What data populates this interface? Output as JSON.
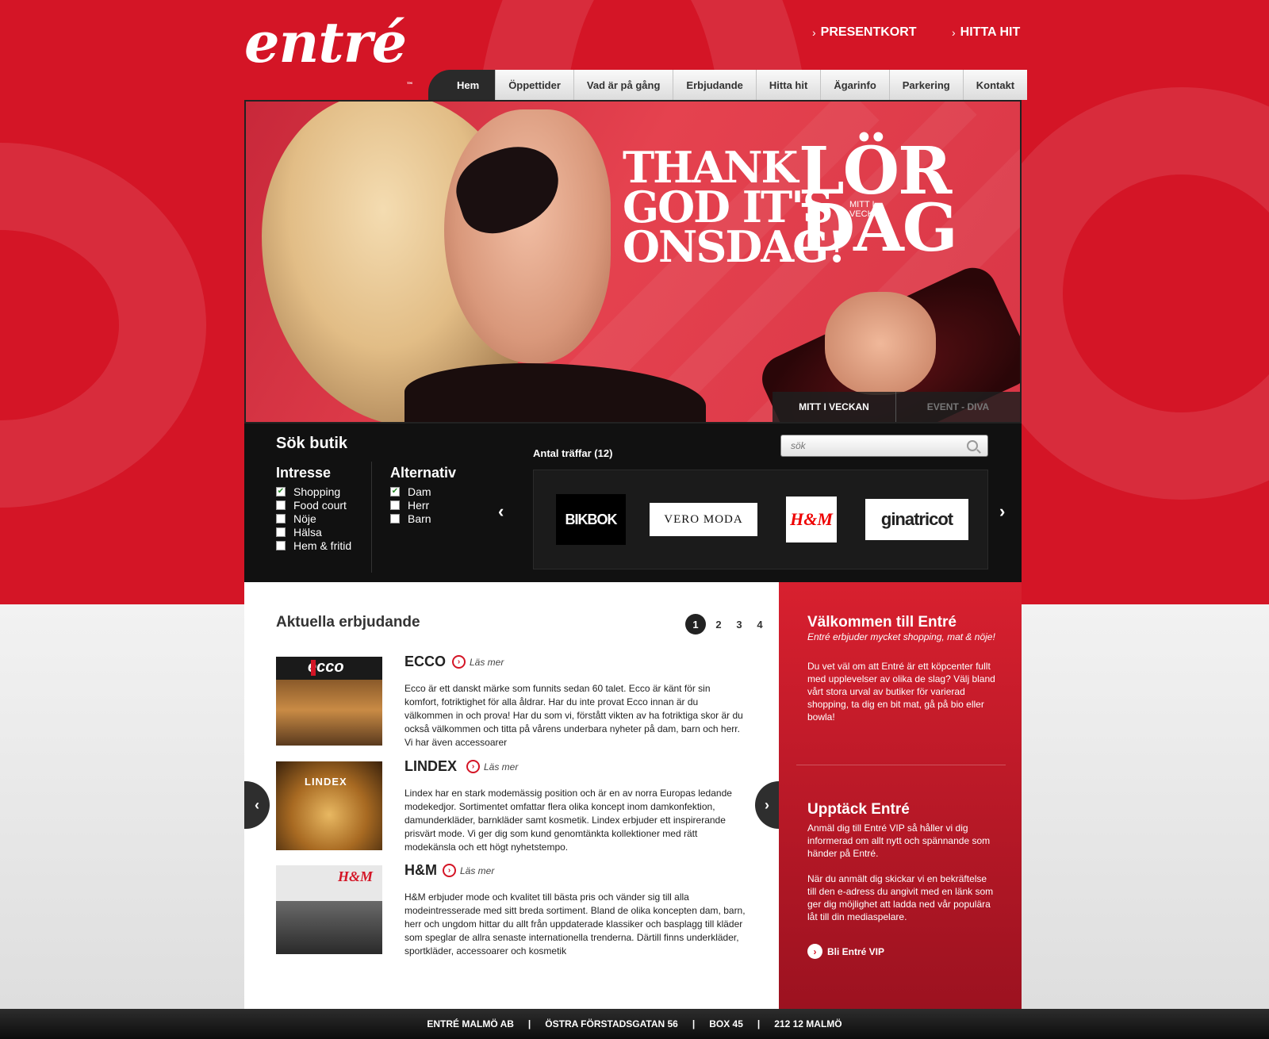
{
  "brand": {
    "logo_text": "entré",
    "tm": "™"
  },
  "top_links": [
    {
      "label": "PRESENTKORT"
    },
    {
      "label": "HITTA HIT"
    }
  ],
  "nav": [
    "Hem",
    "Öppettider",
    "Vad är på gång",
    "Erbjudande",
    "Hitta hit",
    "Ägarinfo",
    "Parkering",
    "Kontakt"
  ],
  "hero": {
    "headline_left": [
      "THANK",
      "GOD IT'S",
      "ONSDAG!"
    ],
    "headline_right": [
      "LÖR",
      "DAG"
    ],
    "headline_small": "MITT I VECKAN",
    "tabs": [
      "MITT I VECKAN",
      "EVENT - DIVA"
    ]
  },
  "search": {
    "title": "Sök butik",
    "interest_title": "Intresse",
    "interests": [
      {
        "label": "Shopping",
        "checked": true
      },
      {
        "label": "Food court",
        "checked": false
      },
      {
        "label": "Nöje",
        "checked": false
      },
      {
        "label": "Hälsa",
        "checked": false
      },
      {
        "label": "Hem & fritid",
        "checked": false
      }
    ],
    "alt_title": "Alternativ",
    "alternatives": [
      {
        "label": "Dam",
        "checked": true
      },
      {
        "label": "Herr",
        "checked": false
      },
      {
        "label": "Barn",
        "checked": false
      }
    ],
    "hits_label": "Antal träffar (12)",
    "search_placeholder": "sök",
    "brands": [
      "BIKBOK",
      "VERO MODA",
      "H&M",
      "ginatricot"
    ]
  },
  "offers": {
    "title": "Aktuella erbjudande",
    "pages": [
      "1",
      "2",
      "3",
      "4"
    ],
    "read_more": "Läs mer",
    "items": [
      {
        "name": "ECCO",
        "img_label": "ecco",
        "text": "Ecco är ett danskt märke som funnits sedan 60 talet. Ecco är känt för sin komfort, fotriktighet för alla åldrar. Har du inte provat Ecco innan är du välkommen in och prova! Har du som vi, förstått vikten av ha fotriktiga skor är du också välkommen och titta på vårens underbara nyheter på dam, barn och herr. Vi har även accessoarer"
      },
      {
        "name": "LINDEX",
        "img_label": "LINDEX",
        "text": "Lindex har en stark modemässig position och är en av norra Europas ledande modekedjor. Sortimentet omfattar flera olika koncept inom damkonfektion, damunderkläder, barnkläder samt kosmetik. Lindex erbjuder ett inspirerande prisvärt mode. Vi ger dig som kund genomtänkta kollektioner med rätt modekänsla och ett högt nyhetstempo."
      },
      {
        "name": "H&M",
        "img_label": "H&M",
        "text": "H&M erbjuder mode och kvalitet till bästa pris och vänder sig till alla modeintresserade med sitt breda sortiment. Bland de olika koncepten dam, barn, herr och ungdom hittar du allt från uppdaterade klassiker och basplagg till kläder som speglar de allra senaste internationella trenderna. Därtill finns underkläder, sportkläder, accessoarer och kosmetik"
      }
    ]
  },
  "sidebar": {
    "welcome_title": "Välkommen till Entré",
    "welcome_sub": "Entré erbjuder mycket shopping, mat & nöje!",
    "welcome_text": "Du vet väl om att Entré är ett köpcenter fullt med upplevelser av olika de slag? Välj bland vårt stora urval av butiker för varierad shopping, ta dig en bit mat, gå på bio eller bowla!",
    "discover_title": "Upptäck Entré",
    "discover_text1": "Anmäl dig till Entré VIP så håller vi dig informerad om allt nytt och spännande som händer på Entré.",
    "discover_text2": "När du anmält dig skickar vi en bekräftelse till den e-adress du angivit med en länk som ger dig möjlighet att ladda ned vår populära låt till din mediaspelare.",
    "vip_link": "Bli Entré VIP"
  },
  "footer": [
    "ENTRÉ MALMÖ AB",
    "|",
    "ÖSTRA FÖRSTADSGATAN 56",
    "|",
    "BOX 45",
    "|",
    "212 12 MALMÖ"
  ],
  "colors": {
    "brand_red": "#d41526",
    "dark": "#111111"
  }
}
